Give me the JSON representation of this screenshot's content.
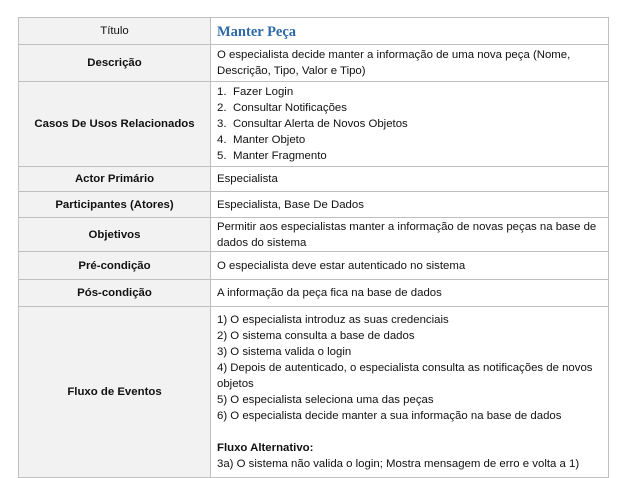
{
  "rows": {
    "title": {
      "label": "Título",
      "value": "Manter Peça"
    },
    "description": {
      "label": "Descrição",
      "value": "O especialista decide manter a informação de uma nova peça (Nome, Descrição, Tipo, Valor e Tipo)"
    },
    "related_use_cases": {
      "label": "Casos De Usos Relacionados",
      "items": [
        {
          "num": "1.",
          "text": "Fazer Login"
        },
        {
          "num": "2.",
          "text": "Consultar Notificações"
        },
        {
          "num": "3.",
          "text": "Consultar Alerta de Novos Objetos"
        },
        {
          "num": "4.",
          "text": "Manter Objeto"
        },
        {
          "num": "5.",
          "text": "Manter Fragmento"
        }
      ]
    },
    "primary_actor": {
      "label": "Actor Primário",
      "value": "Especialista"
    },
    "participants": {
      "label": "Participantes (Atores)",
      "value": "Especialista, Base De Dados"
    },
    "objectives": {
      "label": "Objetivos",
      "value": "Permitir aos especialistas manter a informação de novas peças na base de dados do sistema"
    },
    "precondition": {
      "label": "Pré-condição",
      "value": "O especialista deve estar autenticado no sistema"
    },
    "postcondition": {
      "label": "Pós-condição",
      "value": "A informação da peça fica na base de dados"
    },
    "event_flow": {
      "label": "Fluxo de Eventos",
      "steps": [
        "1) O especialista introduz as suas credenciais",
        "2) O sistema consulta a base de dados",
        "3) O sistema valida o login",
        "4) Depois de autenticado, o especialista consulta as notificações de novos objetos",
        "5) O especialista seleciona uma das peças",
        "6) O especialista decide manter a sua informação na base de dados"
      ],
      "alternative_title": "Fluxo Alternativo:",
      "alternative_steps": [
        "3a) O sistema não valida o login; Mostra mensagem de erro e volta a 1)"
      ]
    }
  }
}
